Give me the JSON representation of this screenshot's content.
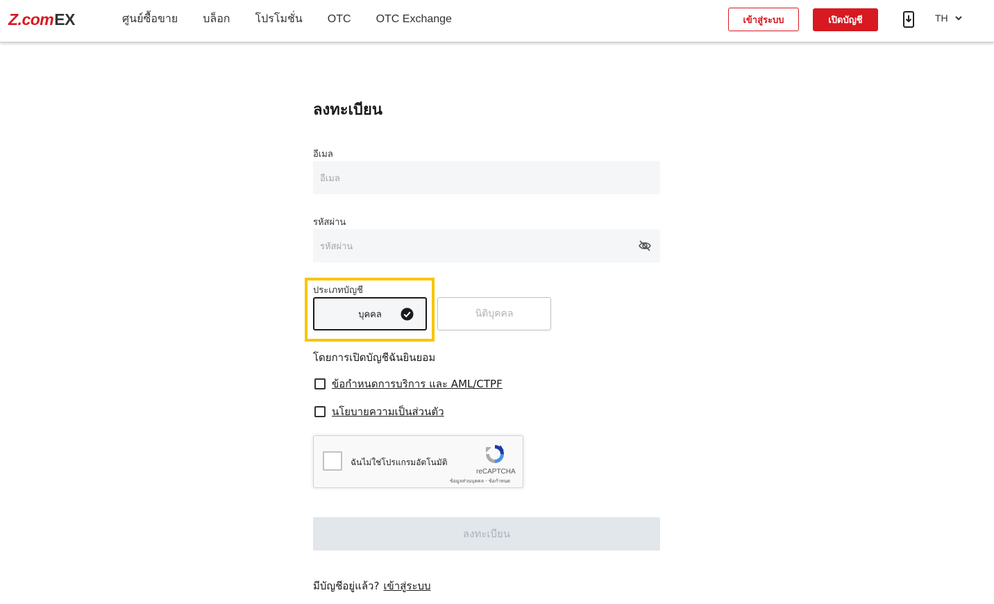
{
  "header": {
    "logo_brand": "Z.com",
    "logo_suffix": "EX",
    "nav": [
      "ศูนย์ซื้อขาย",
      "บล็อก",
      "โปรโมชั่น",
      "OTC",
      "OTC Exchange"
    ],
    "login_label": "เข้าสู่ระบบ",
    "open_account_label": "เปิดบัญชี",
    "language": "TH",
    "accent_color": "#d71921"
  },
  "form": {
    "title": "ลงทะเบียน",
    "email_label": "อีเมล",
    "email_placeholder": "อีเมล",
    "password_label": "รหัสผ่าน",
    "password_placeholder": "รหัสผ่าน",
    "account_type_label": "ประเภทบัญชี",
    "account_types": [
      "บุคคล",
      "นิติบุคคล"
    ],
    "selected_account_type": "บุคคล",
    "agree_text": "โดยการเปิดบัญชีฉันยินยอม",
    "terms_link": "ข้อกำหนดการบริการ และ AML/CTPF",
    "privacy_link": "นโยบายความเป็นส่วนตัว",
    "submit_label": "ลงทะเบียน",
    "has_account_text": "มีบัญชีอยู่แล้ว?",
    "login_link": "เข้าสู่ระบบ"
  },
  "recaptcha": {
    "label": "ฉันไม่ใช่โปรแกรมอัตโนมัติ",
    "brand": "reCAPTCHA",
    "links": "ข้อมูลส่วนบุคคล - ข้อกำหนด"
  }
}
